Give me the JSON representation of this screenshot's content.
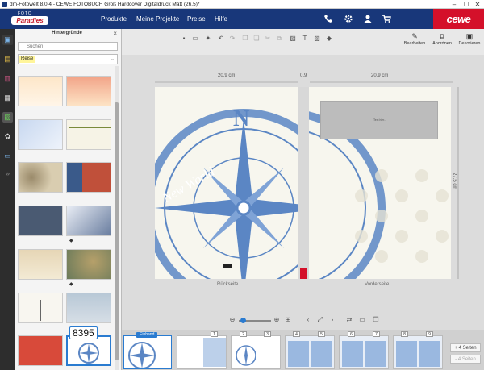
{
  "window": {
    "title": "dm-Fotowelt 8.0.4 - CEWE FOTOBUCH Groß Hardcover Digitaldruck Matt (26.5)*",
    "min": "–",
    "max": "☐",
    "close": "✕"
  },
  "brand": {
    "top": "FOTO",
    "name": "Paradies",
    "cewe": "cewe"
  },
  "menu": {
    "items": [
      "Produkte",
      "Meine Projekte",
      "Preise",
      "Hilfe"
    ]
  },
  "header_icons": [
    "phone-icon",
    "gear-icon",
    "user-icon",
    "cart-icon"
  ],
  "panel": {
    "title": "Hintergründe",
    "close": "×",
    "search_placeholder": "Suchen",
    "category": "Reise",
    "tooltip": "8395"
  },
  "toolbar_right": [
    {
      "label": "Bearbeiten",
      "icon": "edit-icon"
    },
    {
      "label": "Anordnen",
      "icon": "arrange-icon"
    },
    {
      "label": "Dekorieren",
      "icon": "decorate-icon"
    }
  ],
  "dimensions": {
    "left_width": "20,9 cm",
    "spine": "0,9",
    "right_width": "20,9 cm",
    "height": "27,5 cm"
  },
  "pages": {
    "back": "Rückseite",
    "front": "Vorderseite",
    "placeholder": "Text hier..."
  },
  "compass": {
    "n": "N",
    "text": "New World"
  },
  "strip": {
    "einband": "Einband",
    "numbers": [
      "1",
      "2",
      "3",
      "4",
      "5",
      "6",
      "7",
      "8",
      "9"
    ],
    "add1": "+ 4 Seiten",
    "add2": "- 4 Seiten"
  },
  "colors": {
    "navy": "#18377a",
    "cewe_red": "#d4102a",
    "compass_blue": "#5b86c4",
    "selection": "#2a7bd0"
  }
}
